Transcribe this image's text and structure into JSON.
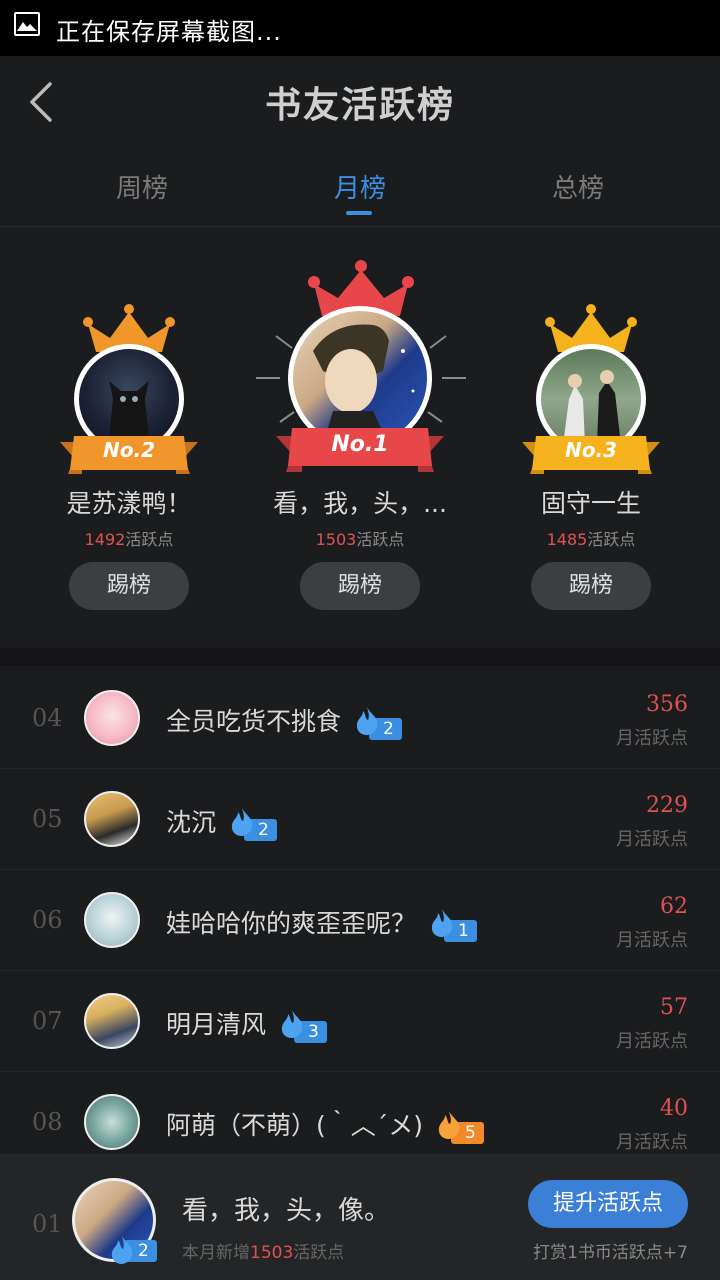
{
  "status_bar": {
    "text": "正在保存屏幕截图..."
  },
  "header": {
    "title": "书友活跃榜"
  },
  "tabs": [
    "周榜",
    "月榜",
    "总榜"
  ],
  "active_tab": "月榜",
  "podium": [
    {
      "badge": "No.2",
      "name": "是苏漾鸭！",
      "points": "1492",
      "points_unit": "活跃点",
      "button": "踢榜",
      "crown_color": "#f0962a"
    },
    {
      "badge": "No.1",
      "name": "看，我，头，...",
      "points": "1503",
      "points_unit": "活跃点",
      "button": "踢榜",
      "crown_color": "#e8474a"
    },
    {
      "badge": "No.3",
      "name": "固守一生",
      "points": "1485",
      "points_unit": "活跃点",
      "button": "踢榜",
      "crown_color": "#f5b21c"
    }
  ],
  "rows": [
    {
      "rank": "04",
      "name": "全员吃货不挑食",
      "level": "2",
      "value": "356",
      "unit": "月活跃点"
    },
    {
      "rank": "05",
      "name": "沈沉",
      "level": "2",
      "value": "229",
      "unit": "月活跃点"
    },
    {
      "rank": "06",
      "name": "娃哈哈你的爽歪歪呢？",
      "level": "1",
      "value": "62",
      "unit": "月活跃点"
    },
    {
      "rank": "07",
      "name": "明月清风",
      "level": "3",
      "value": "57",
      "unit": "月活跃点"
    },
    {
      "rank": "08",
      "name": "阿萌（不萌）(｀︿´メ)",
      "level": "5",
      "value": "40",
      "unit": "月活跃点"
    }
  ],
  "footer": {
    "rank": "01",
    "name": "看，我，头，像。",
    "level": "2",
    "sub_prefix": "本月新增",
    "sub_value": "1503",
    "sub_suffix": "活跃点",
    "button": "提升活跃点",
    "note": "打赏1书币活跃点+7"
  },
  "colors": {
    "accent": "#3b8fe0",
    "points_red": "#e05252",
    "bg": "#1b1c1e"
  }
}
